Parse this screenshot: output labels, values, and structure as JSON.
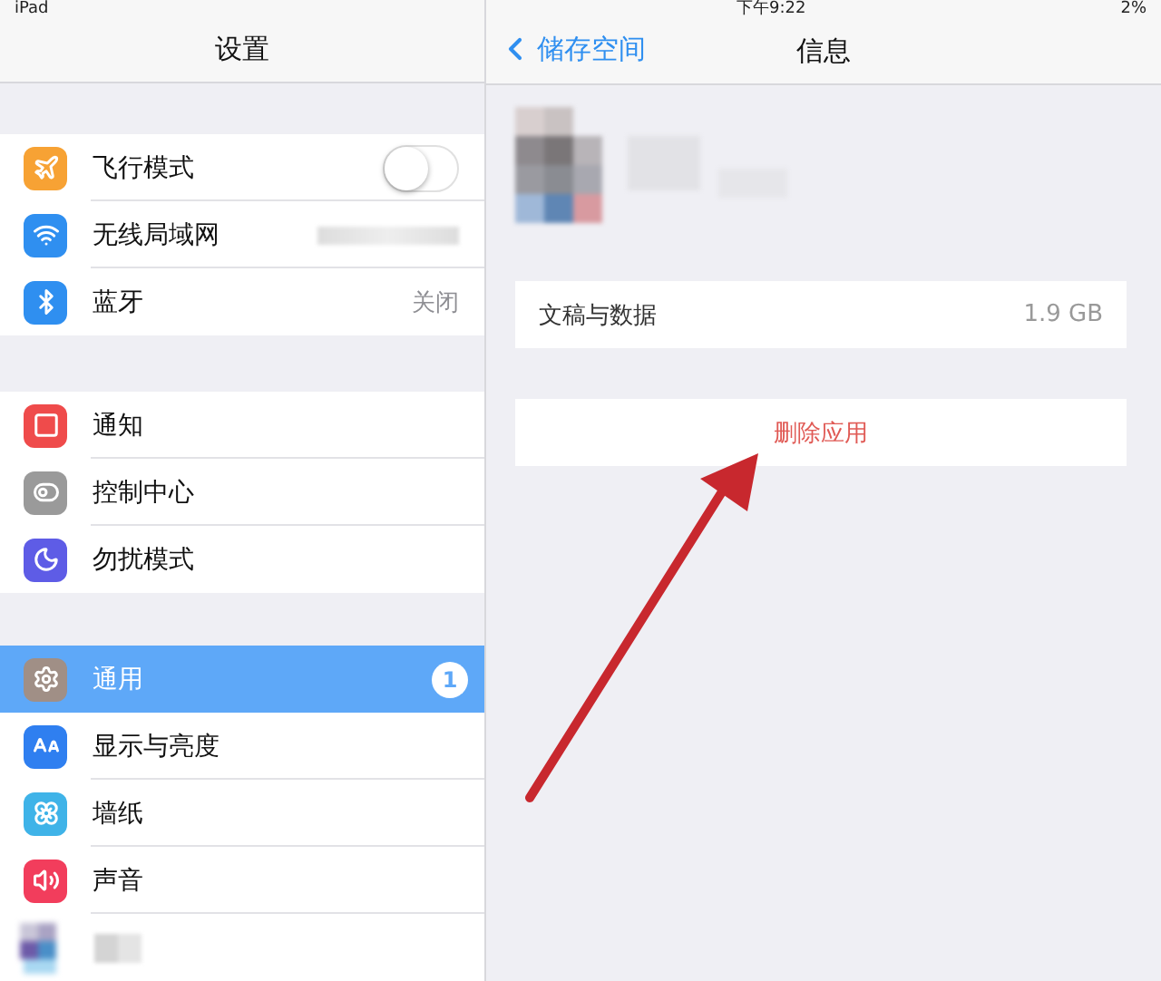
{
  "status_bar": {
    "device": "iPad",
    "time": "下午9:22",
    "battery": "2%"
  },
  "sidebar": {
    "title": "设置",
    "groups": [
      [
        {
          "kind": "toggle",
          "label": "飞行模式",
          "color": "#f7a234",
          "on": false,
          "selected": false
        },
        {
          "kind": "blurred_value",
          "label": "无线局域网",
          "color": "#2f8ff0",
          "selected": false
        },
        {
          "kind": "value",
          "label": "蓝牙",
          "value": "关闭",
          "color": "#2f8ff0",
          "selected": false
        }
      ],
      [
        {
          "kind": "link",
          "label": "通知",
          "color": "#ef4b4b",
          "selected": false
        },
        {
          "kind": "link",
          "label": "控制中心",
          "color": "#9a9a9a",
          "selected": false
        },
        {
          "kind": "link",
          "label": "勿扰模式",
          "color": "#5e5ce6",
          "selected": false
        }
      ],
      [
        {
          "kind": "badge",
          "label": "通用",
          "badge": "1",
          "color": "#a08f86",
          "selected": true
        },
        {
          "kind": "link",
          "label": "显示与亮度",
          "color": "#2f7ff0",
          "selected": false
        },
        {
          "kind": "link",
          "label": "墙纸",
          "color": "#3fb3e8",
          "selected": false
        },
        {
          "kind": "link",
          "label": "声音",
          "color": "#f23d5c",
          "selected": false
        },
        {
          "kind": "blurred",
          "selected": false
        }
      ]
    ]
  },
  "detail": {
    "back": "储存空间",
    "title": "信息",
    "storage": {
      "label": "文稿与数据",
      "value": "1.9 GB"
    },
    "delete_button": "删除应用"
  }
}
